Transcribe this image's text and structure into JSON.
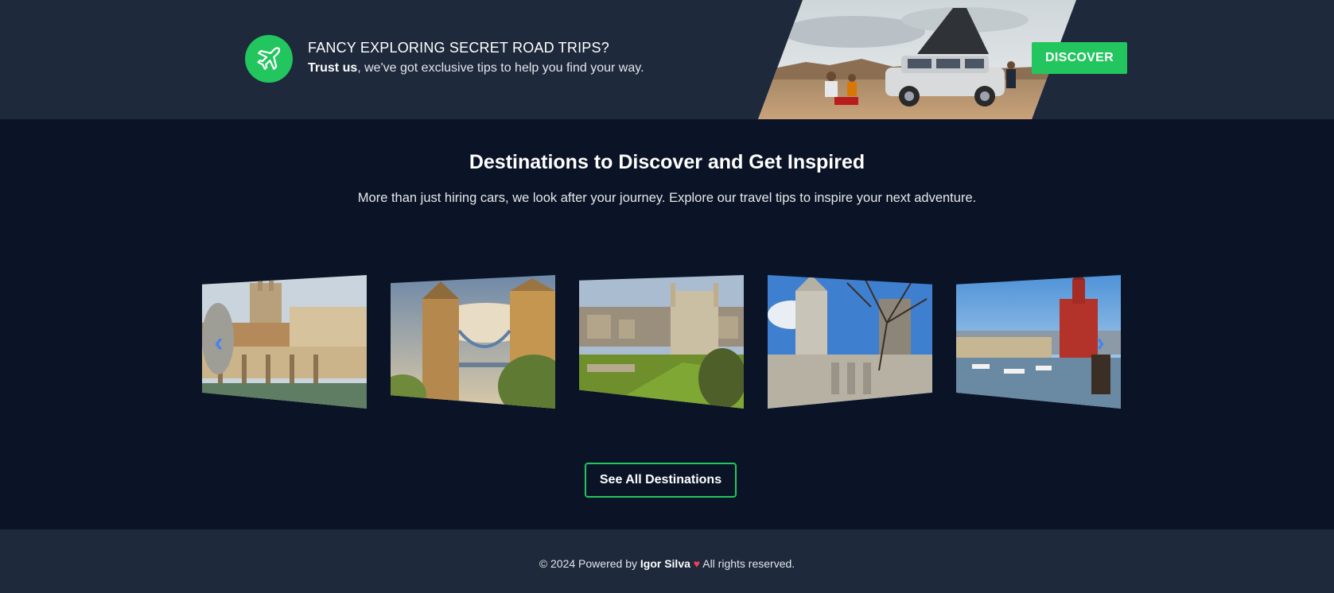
{
  "banner": {
    "title": "FANCY EXPLORING SECRET ROAD TRIPS?",
    "subtitle_bold": "Trust us",
    "subtitle_rest": ", we've got exclusive tips to help you find your way.",
    "icon": "airplane-icon",
    "cta_label": "DISCOVER"
  },
  "destinations": {
    "title": "Destinations to Discover and Get Inspired",
    "description": "More than just hiring cars, we look after your journey. Explore our travel tips to inspire your next adventure.",
    "cards": [
      {
        "image": "roman-baths-photo"
      },
      {
        "image": "tower-bridge-photo"
      },
      {
        "image": "kings-college-photo"
      },
      {
        "image": "canterbury-cathedral-photo"
      },
      {
        "image": "cardiff-bay-photo"
      }
    ],
    "prev_arrow": "‹",
    "next_arrow": "›",
    "see_all_label": "See All Destinations"
  },
  "footer": {
    "prefix": "© 2024 Powered by ",
    "author": "Igor Silva",
    "heart": "♥",
    "suffix": " All rights reserved."
  },
  "colors": {
    "accent": "#22c55e",
    "banner_bg": "#1e293b",
    "page_bg": "#0b1426",
    "arrow": "#3b82f6",
    "heart": "#f43f5e"
  }
}
